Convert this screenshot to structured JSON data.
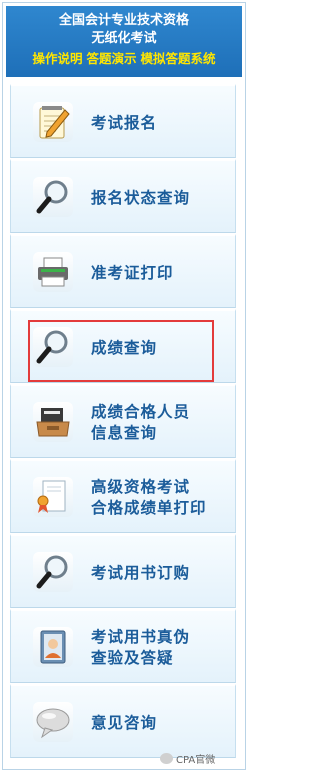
{
  "header": {
    "line1": "全国会计专业技术资格",
    "line2": "无纸化考试",
    "links": [
      "操作说明",
      "答题演示",
      "模拟答题系统"
    ]
  },
  "menu": [
    {
      "label": "考试报名",
      "icon": "notepad-pencil-icon"
    },
    {
      "label": "报名状态查询",
      "icon": "magnifier-icon"
    },
    {
      "label": "准考证打印",
      "icon": "printer-icon"
    },
    {
      "label": "成绩查询",
      "icon": "magnifier-icon",
      "highlighted": true
    },
    {
      "label_lines": [
        "成绩合格人员",
        "信息查询"
      ],
      "icon": "inbox-tray-icon"
    },
    {
      "label_lines": [
        "高级资格考试",
        "合格成绩单打印"
      ],
      "icon": "certificate-ribbon-icon"
    },
    {
      "label": "考试用书订购",
      "icon": "magnifier-icon"
    },
    {
      "label_lines": [
        "考试用书真伪",
        "查验及答疑"
      ],
      "icon": "user-id-book-icon"
    },
    {
      "label": "意见咨询",
      "icon": "speech-bubble-icon"
    }
  ],
  "colors": {
    "header_bg": "#1e6fb8",
    "header_links": "#ffe600",
    "menu_text": "#1b5c9a",
    "highlight_border": "#e33b3b"
  },
  "watermark": {
    "text": "CPA官微"
  }
}
